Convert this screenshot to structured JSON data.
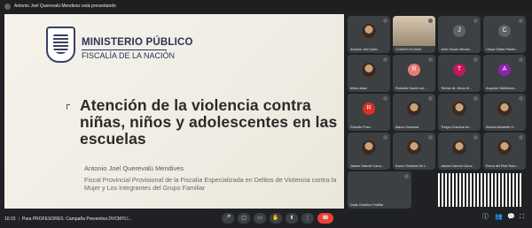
{
  "presenting_banner": "Antonio Joel Querevalú Mendivez está presentando",
  "slide": {
    "org_line1": "MINISTERIO PÚBLICO",
    "org_line2": "FISCALÍA DE LA NACIÓN",
    "title": "Atención de la violencia contra niñas, niños y adolescentes en las escuelas",
    "author": "Antonio Joel Querevalú Mendives",
    "role": "Fiscal Provincial Provisional de la Fiscalía Especializada en Delitos de Violencia contra la Mujer y Los Integrantes del Grupo Familiar"
  },
  "participants": [
    {
      "name": "Antonio Joel Quer...",
      "kind": "photo"
    },
    {
      "name": "COAVIO ELIANA",
      "kind": "cam"
    },
    {
      "name": "José Oscar Hernan...",
      "kind": "avatar",
      "initial": "J",
      "color": "#5f6368"
    },
    {
      "name": "César Gilber Pastor...",
      "kind": "avatar",
      "initial": "C",
      "color": "#5f6368"
    },
    {
      "name": "telmo abad",
      "kind": "photo"
    },
    {
      "name": "Rolando David Lun...",
      "kind": "avatar",
      "initial": "R",
      "color": "#e67c73"
    },
    {
      "name": "Teresa de Jesus M...",
      "kind": "avatar",
      "initial": "T",
      "color": "#c2185b"
    },
    {
      "name": "Augusto Valdiviezo...",
      "kind": "avatar",
      "initial": "A",
      "color": "#8e24aa"
    },
    {
      "name": "Ricardo Poso",
      "kind": "avatar",
      "initial": "R",
      "color": "#d93025"
    },
    {
      "name": "Marco Gamboa",
      "kind": "photo"
    },
    {
      "name": "Thugul Graciela Iw...",
      "kind": "photo"
    },
    {
      "name": "Karina elizabeth G...",
      "kind": "photo"
    },
    {
      "name": "James Darmel Carru...",
      "kind": "photo"
    },
    {
      "name": "Karen Giuliana De L...",
      "kind": "photo"
    },
    {
      "name": "James Darmel Carru...",
      "kind": "photo"
    },
    {
      "name": "Elena del Pilar Ram...",
      "kind": "photo"
    },
    {
      "name": "Dalia Ordoñez Portilla",
      "kind": "blank"
    }
  ],
  "bottom": {
    "time": "10:15",
    "meeting": "Para PROFESORES: Campaña Preventiva DVCMYLI..."
  }
}
